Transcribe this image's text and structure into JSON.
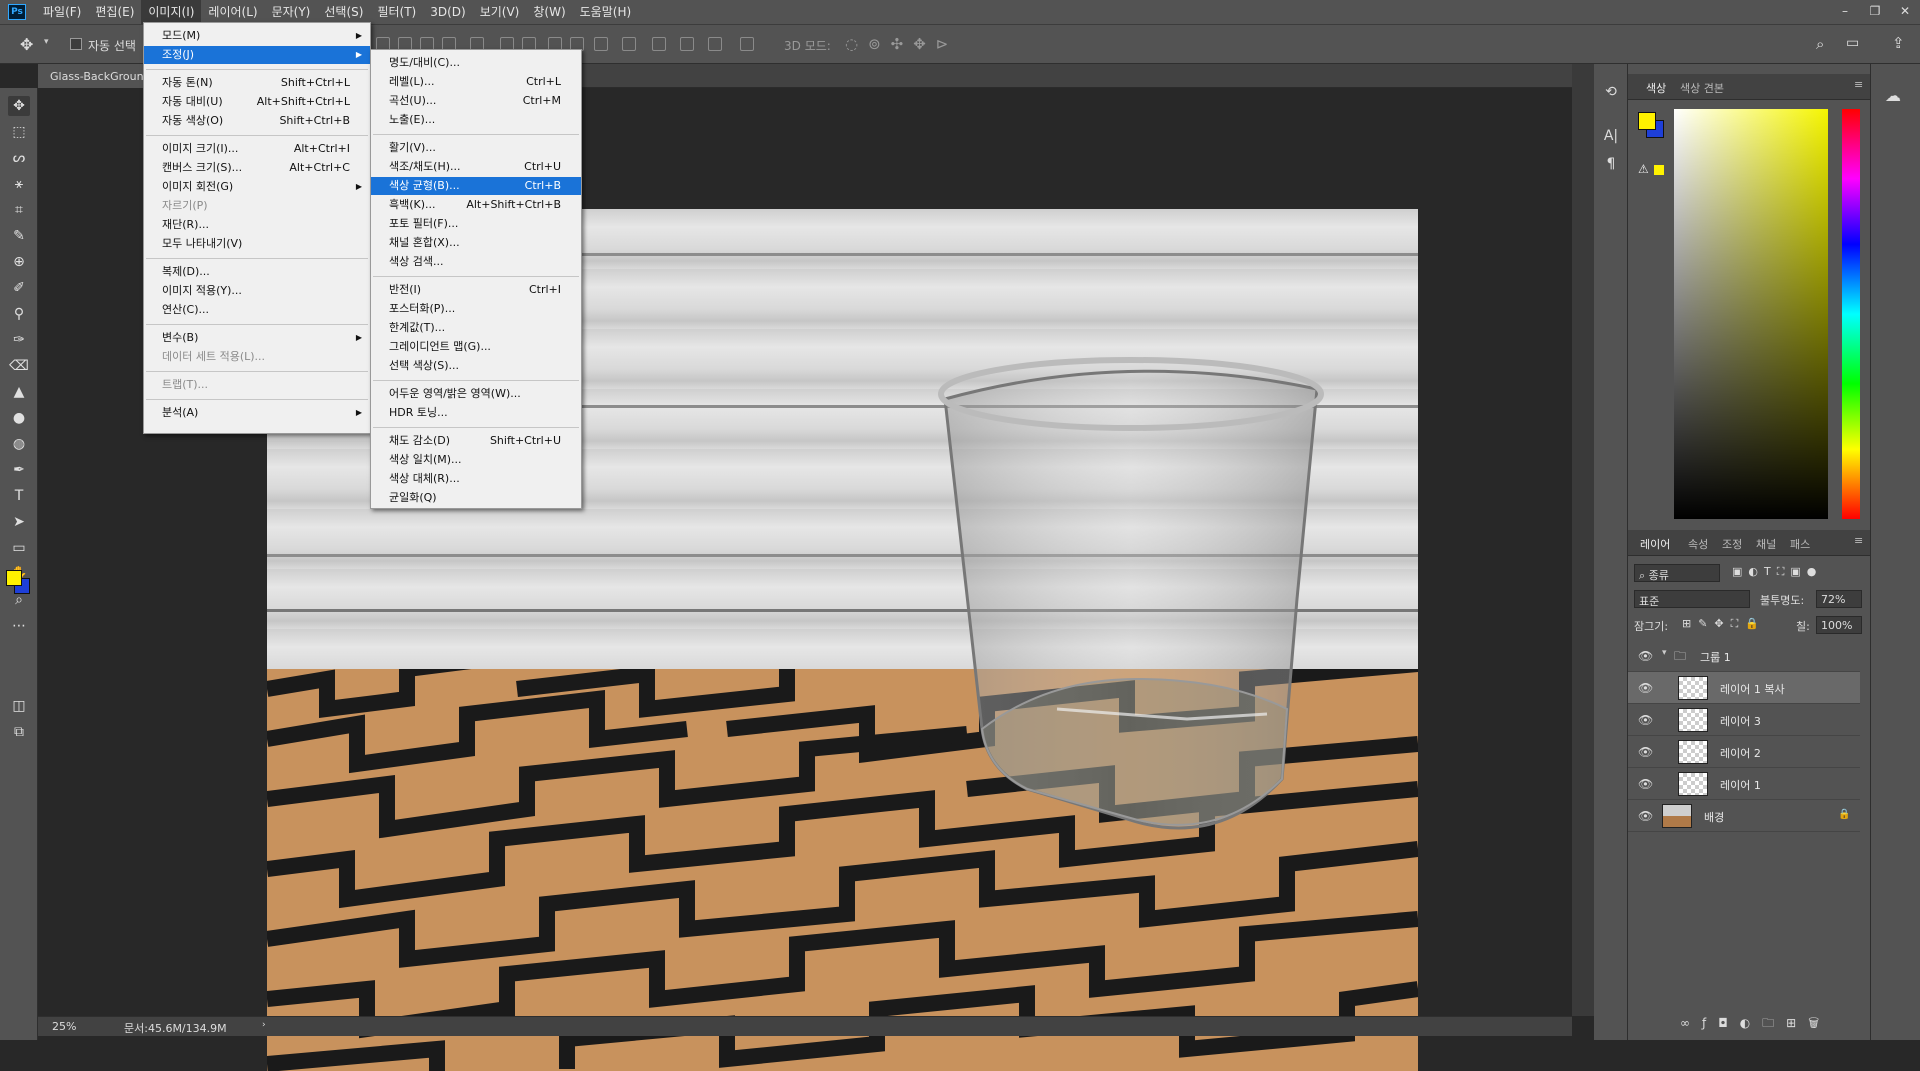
{
  "app": {
    "logo": "Ps"
  },
  "menubar": [
    "파일(F)",
    "편집(E)",
    "이미지(I)",
    "레이어(L)",
    "문자(Y)",
    "선택(S)",
    "필터(T)",
    "3D(D)",
    "보기(V)",
    "창(W)",
    "도움말(H)"
  ],
  "options": {
    "auto_select": "자동 선택",
    "mode3d": "3D 모드:"
  },
  "document": {
    "tab": "Glass-BackGround.jpg"
  },
  "status": {
    "zoom": "25%",
    "doc": "문서:45.6M/134.9M"
  },
  "image_menu": [
    {
      "l": "모드(M)",
      "s": "",
      "arrow": true
    },
    {
      "l": "조정(J)",
      "s": "",
      "arrow": true,
      "hi": true
    },
    {
      "l": "자동 톤(N)",
      "s": "Shift+Ctrl+L"
    },
    {
      "l": "자동 대비(U)",
      "s": "Alt+Shift+Ctrl+L"
    },
    {
      "l": "자동 색상(O)",
      "s": "Shift+Ctrl+B"
    },
    {
      "l": "이미지 크기(I)...",
      "s": "Alt+Ctrl+I"
    },
    {
      "l": "캔버스 크기(S)...",
      "s": "Alt+Ctrl+C"
    },
    {
      "l": "이미지 회전(G)",
      "s": "",
      "arrow": true
    },
    {
      "l": "자르기(P)",
      "s": "",
      "dis": true
    },
    {
      "l": "재단(R)...",
      "s": ""
    },
    {
      "l": "모두 나타내기(V)",
      "s": ""
    },
    {
      "l": "복제(D)...",
      "s": ""
    },
    {
      "l": "이미지 적용(Y)...",
      "s": ""
    },
    {
      "l": "연산(C)...",
      "s": ""
    },
    {
      "l": "변수(B)",
      "s": "",
      "arrow": true
    },
    {
      "l": "데이터 세트 적용(L)...",
      "s": "",
      "dis": true
    },
    {
      "l": "트랩(T)...",
      "s": "",
      "dis": true
    },
    {
      "l": "분석(A)",
      "s": "",
      "arrow": true
    }
  ],
  "adjust_menu": [
    {
      "l": "명도/대비(C)...",
      "s": ""
    },
    {
      "l": "레벨(L)...",
      "s": "Ctrl+L"
    },
    {
      "l": "곡선(U)...",
      "s": "Ctrl+M"
    },
    {
      "l": "노출(E)...",
      "s": ""
    },
    {
      "l": "활기(V)...",
      "s": ""
    },
    {
      "l": "색조/채도(H)...",
      "s": "Ctrl+U"
    },
    {
      "l": "색상 균형(B)...",
      "s": "Ctrl+B",
      "hi": true
    },
    {
      "l": "흑백(K)...",
      "s": "Alt+Shift+Ctrl+B"
    },
    {
      "l": "포토 필터(F)...",
      "s": ""
    },
    {
      "l": "채널 혼합(X)...",
      "s": ""
    },
    {
      "l": "색상 검색...",
      "s": ""
    },
    {
      "l": "반전(I)",
      "s": "Ctrl+I"
    },
    {
      "l": "포스터화(P)...",
      "s": ""
    },
    {
      "l": "한계값(T)...",
      "s": ""
    },
    {
      "l": "그레이디언트 맵(G)...",
      "s": ""
    },
    {
      "l": "선택 색상(S)...",
      "s": ""
    },
    {
      "l": "어두운 영역/밝은 영역(W)...",
      "s": ""
    },
    {
      "l": "HDR 토닝...",
      "s": ""
    },
    {
      "l": "채도 감소(D)",
      "s": "Shift+Ctrl+U"
    },
    {
      "l": "색상 일치(M)...",
      "s": ""
    },
    {
      "l": "색상 대체(R)...",
      "s": ""
    },
    {
      "l": "균일화(Q)",
      "s": ""
    }
  ],
  "color_panel": {
    "tabs": [
      "색상",
      "색상 견본"
    ]
  },
  "layers_panel": {
    "tabs": [
      "레이어",
      "속성",
      "조정",
      "채널",
      "패스"
    ],
    "filter": "종류",
    "blend": "표준",
    "opacity_label": "불투명도:",
    "opacity": "72%",
    "lock_label": "잠그기:",
    "fill_label": "칠:",
    "fill": "100%",
    "group": "그룹 1",
    "layers": [
      "레이어 1 복사",
      "레이어 3",
      "레이어 2",
      "레이어 1",
      "배경"
    ]
  },
  "colors": {
    "fg": "#fff200",
    "bg": "#1e3fd8",
    "highlight": "#1a73d8"
  }
}
